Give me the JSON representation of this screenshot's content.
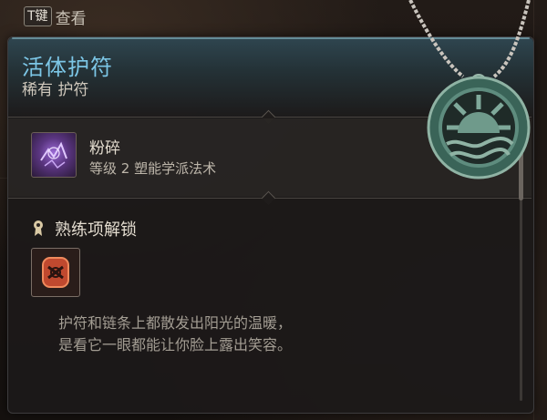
{
  "hint": {
    "key": "T键",
    "label": "查看"
  },
  "item": {
    "name": "活体护符",
    "rarity": "稀有 护符"
  },
  "spell": {
    "name": "粉碎",
    "description": "等级 2 塑能学派法术",
    "icon": "shatter-spell-icon"
  },
  "proficiency": {
    "title": "熟练项解锁",
    "icon": "proficiency-unlock-icon",
    "item_icon": "proficiency-rune-icon"
  },
  "flavor": {
    "line1": "护符和链条上都散发出阳光的温暖，",
    "line2": "是看它一眼都能让你脸上露出笑容。"
  },
  "colors": {
    "name_accent": "#7cc6e6",
    "panel_bg": "#1c1919"
  }
}
